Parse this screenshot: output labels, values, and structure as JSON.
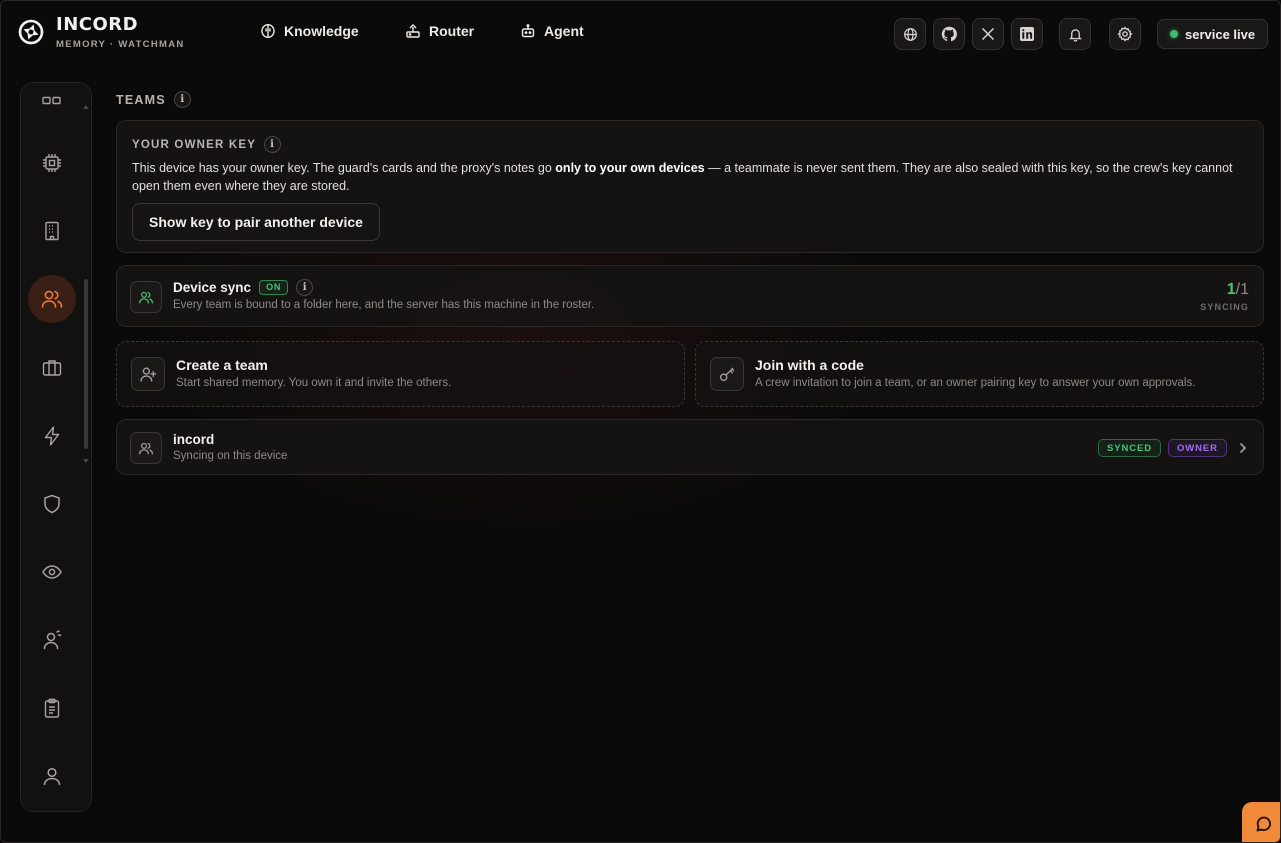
{
  "brand": {
    "name": "INCORD",
    "subtitle": "MEMORY · WATCHMAN"
  },
  "nav": [
    {
      "label": "Knowledge",
      "icon": "brain-icon"
    },
    {
      "label": "Router",
      "icon": "router-icon"
    },
    {
      "label": "Agent",
      "icon": "robot-icon"
    }
  ],
  "top_icons": [
    "globe-icon",
    "github-icon",
    "x-icon",
    "linkedin-icon",
    "bell-icon",
    "gear-icon"
  ],
  "service_status": {
    "label": "service live",
    "color": "#3fbd6d"
  },
  "sidebar": {
    "items": [
      {
        "name": "dashboard",
        "icon": "grid-icon"
      },
      {
        "name": "processor",
        "icon": "chip-icon"
      },
      {
        "name": "buildings",
        "icon": "building-icon"
      },
      {
        "name": "teams",
        "icon": "users-icon",
        "active": true
      },
      {
        "name": "briefcase",
        "icon": "briefcase-icon"
      },
      {
        "name": "activity",
        "icon": "lightning-icon"
      },
      {
        "name": "security",
        "icon": "shield-icon"
      },
      {
        "name": "watch",
        "icon": "eye-icon"
      },
      {
        "name": "agent-user",
        "icon": "user-spark-icon"
      },
      {
        "name": "tasks",
        "icon": "clipboard-icon"
      },
      {
        "name": "profile",
        "icon": "user-icon"
      }
    ],
    "accent": "#f07a3c"
  },
  "main": {
    "section_title": "TEAMS",
    "info_glyph": "i",
    "owner_key": {
      "title": "YOUR OWNER KEY",
      "text_before": "This device has your owner key. The guard's cards and the proxy's notes go ",
      "text_bold": "only to your own devices",
      "text_after": " — a teammate is never sent them. They are also sealed with this key, so the crew's key cannot open them even where they are stored.",
      "button_label": "Show key to pair another device"
    },
    "device_sync": {
      "title": "Device sync",
      "status": "ON",
      "description": "Every team is bound to a folder here, and the server has this machine in the roster.",
      "count_current": "1",
      "count_total": "/1",
      "count_label": "SYNCING"
    },
    "create_team": {
      "title": "Create a team",
      "description": "Start shared memory. You own it and invite the others."
    },
    "join_code": {
      "title": "Join with a code",
      "description": "A crew invitation to join a team, or an owner pairing key to answer your own approvals."
    },
    "team_row": {
      "name": "incord",
      "status": "Syncing on this device",
      "badge_synced": "SYNCED",
      "badge_owner": "OWNER"
    }
  },
  "colors": {
    "green": "#48c47a",
    "purple": "#a46ef0",
    "orange": "#f08a3a"
  }
}
